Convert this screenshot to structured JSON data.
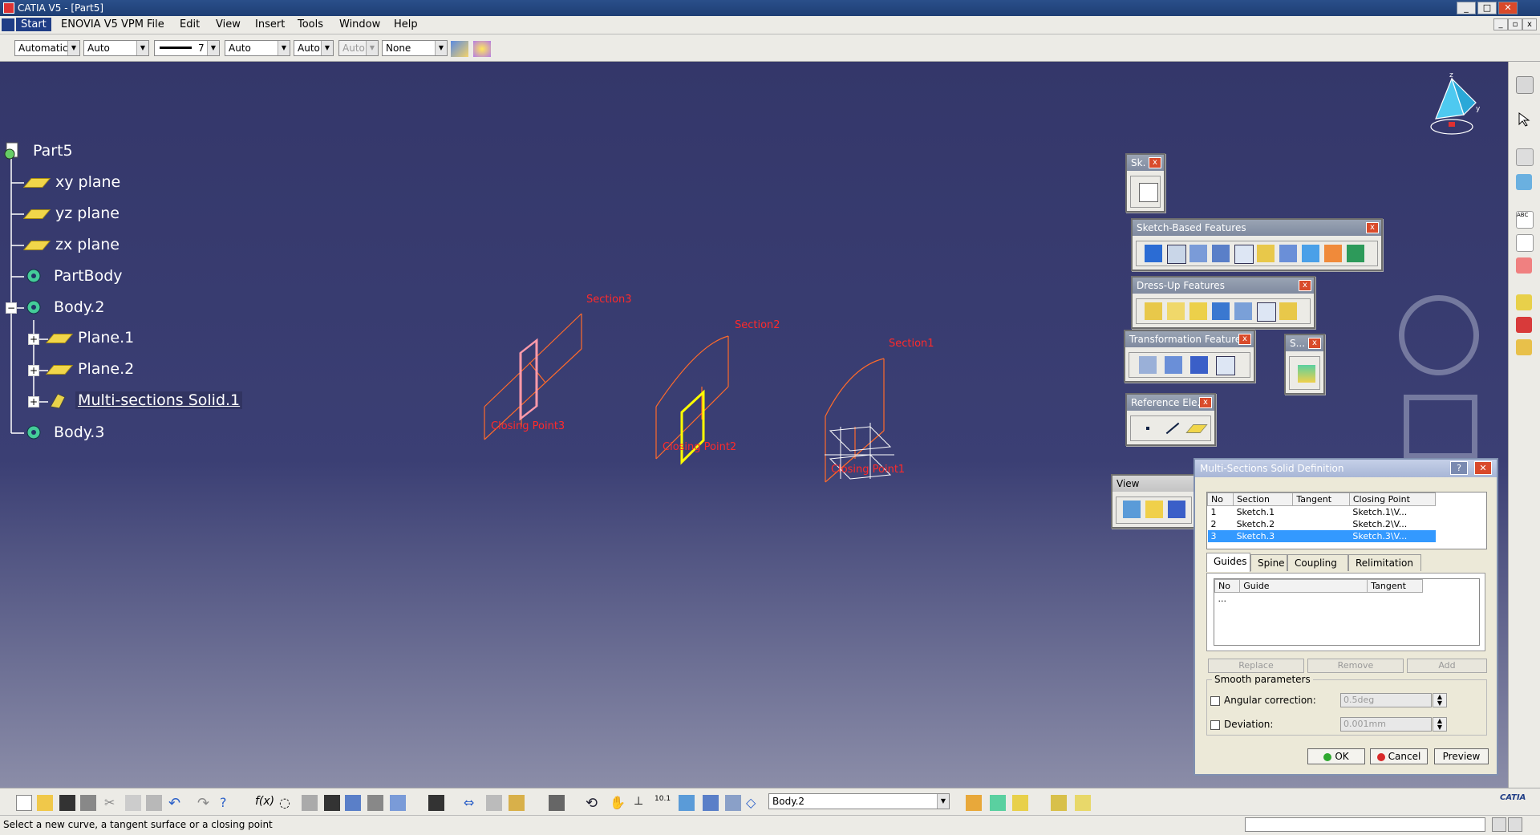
{
  "window": {
    "title": "CATIA V5 - [Part5]",
    "min_btn": "_",
    "max_btn": "□",
    "close_btn": "✕"
  },
  "menu": {
    "start": "Start",
    "items": [
      "ENOVIA V5 VPM",
      "File",
      "Edit",
      "View",
      "Insert",
      "Tools",
      "Window",
      "Help"
    ]
  },
  "props_bar": {
    "color_combo": "Automatic",
    "transparency_combo": "Auto",
    "line_weight_value": "7",
    "line_type_combo": "Auto",
    "point_type_combo": "Auto",
    "layer_combo_disabled": "Auto",
    "render_combo": "None"
  },
  "tree": {
    "root": "Part5",
    "items": [
      "xy plane",
      "yz plane",
      "zx plane",
      "PartBody",
      "Body.2",
      "Plane.1",
      "Plane.2",
      "Multi-sections Solid.1",
      "Body.3"
    ]
  },
  "geometry_labels": {
    "section_left": "Section3",
    "section_mid": "Section2",
    "section_right": "Section1",
    "closing_left": "Closing Point3",
    "closing_mid": "Closing Point2",
    "closing_right": "Closing Point1"
  },
  "toolbars": {
    "sketcher": "Sk.",
    "sketch_based": "Sketch-Based Features",
    "dress_up": "Dress-Up Features",
    "transformation": "Transformation Features",
    "surface_small": "S...",
    "reference": "Reference Ele...",
    "view": "View"
  },
  "dialog": {
    "title": "Multi-Sections Solid Definition",
    "help_btn": "?",
    "close_btn": "✕",
    "columns": [
      "No",
      "Section",
      "Tangent",
      "Closing Point"
    ],
    "rows": [
      {
        "no": "1",
        "section": "Sketch.1",
        "tangent": "",
        "closing": "Sketch.1\\V..."
      },
      {
        "no": "2",
        "section": "Sketch.2",
        "tangent": "",
        "closing": "Sketch.2\\V..."
      },
      {
        "no": "3",
        "section": "Sketch.3",
        "tangent": "",
        "closing": "Sketch.3\\V..."
      }
    ],
    "tabs": [
      "Guides",
      "Spine",
      "Coupling",
      "Relimitation"
    ],
    "guide_columns": [
      "No",
      "Guide",
      "Tangent"
    ],
    "guide_placeholder": "...",
    "btn_replace": "Replace",
    "btn_remove": "Remove",
    "btn_add": "Add",
    "smooth_group": "Smooth parameters",
    "angular_label": "Angular correction:",
    "angular_value": "0.5deg",
    "deviation_label": "Deviation:",
    "deviation_value": "0.001mm",
    "btn_ok": "OK",
    "btn_cancel": "Cancel",
    "btn_preview": "Preview"
  },
  "bottom": {
    "current_body": "Body.2",
    "status": "Select a new curve, a tangent surface or a closing point",
    "catia_logo": "CATIA"
  },
  "colors": {
    "viewport_top": "#34376a",
    "geometry": "#ff6a2a",
    "selected_sketch": "#ffff00",
    "selection_row": "#3399ff"
  }
}
